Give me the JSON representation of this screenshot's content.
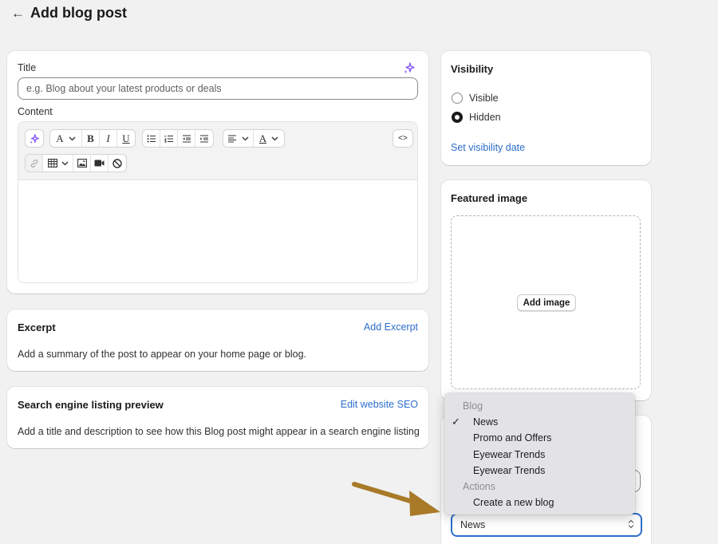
{
  "header": {
    "back_icon": "arrow-left-icon",
    "title": "Add blog post"
  },
  "main_card": {
    "title_label": "Title",
    "title_placeholder": "e.g. Blog about your latest products or deals",
    "content_label": "Content",
    "toolbar": {
      "row1": [
        "magic-icon",
        "font-icon",
        "bold-icon",
        "italic-icon",
        "underline-icon",
        "bulleted-list-icon",
        "numbered-list-icon",
        "outdent-icon",
        "indent-icon",
        "align-left-icon",
        "text-color-icon",
        "code-view-icon"
      ],
      "row2": [
        "link-icon",
        "table-icon",
        "image-icon",
        "video-icon",
        "clear-formatting-icon"
      ],
      "font_glyph": "A",
      "bold_glyph": "B",
      "italic_glyph": "I",
      "underline_glyph": "U",
      "color_glyph": "A",
      "code_glyph": "<>"
    }
  },
  "excerpt": {
    "title": "Excerpt",
    "action": "Add Excerpt",
    "description": "Add a summary of the post to appear on your home page or blog."
  },
  "seo": {
    "title": "Search engine listing preview",
    "action": "Edit website SEO",
    "description": "Add a title and description to see how this Blog post might appear in a search engine listing"
  },
  "visibility": {
    "title": "Visibility",
    "options": [
      {
        "label": "Visible",
        "checked": false
      },
      {
        "label": "Hidden",
        "checked": true
      }
    ],
    "link": "Set visibility date"
  },
  "featured_image": {
    "title": "Featured image",
    "button": "Add image"
  },
  "organization": {
    "blog_select_value": "News"
  },
  "dropdown": {
    "groups": [
      {
        "label": "Blog",
        "items": [
          {
            "label": "News",
            "selected": true
          },
          {
            "label": "Promo and Offers",
            "selected": false
          },
          {
            "label": "Eyewear Trends",
            "selected": false
          },
          {
            "label": "Eyewear Trends",
            "selected": false
          }
        ]
      },
      {
        "label": "Actions",
        "items": [
          {
            "label": "Create a new blog",
            "selected": false
          }
        ]
      }
    ],
    "check_glyph": "✓"
  },
  "colors": {
    "accent": "#2c6ecb",
    "magic": "#8051ff",
    "annotation_arrow": "#a87a28",
    "background": "#f1f1f1"
  }
}
